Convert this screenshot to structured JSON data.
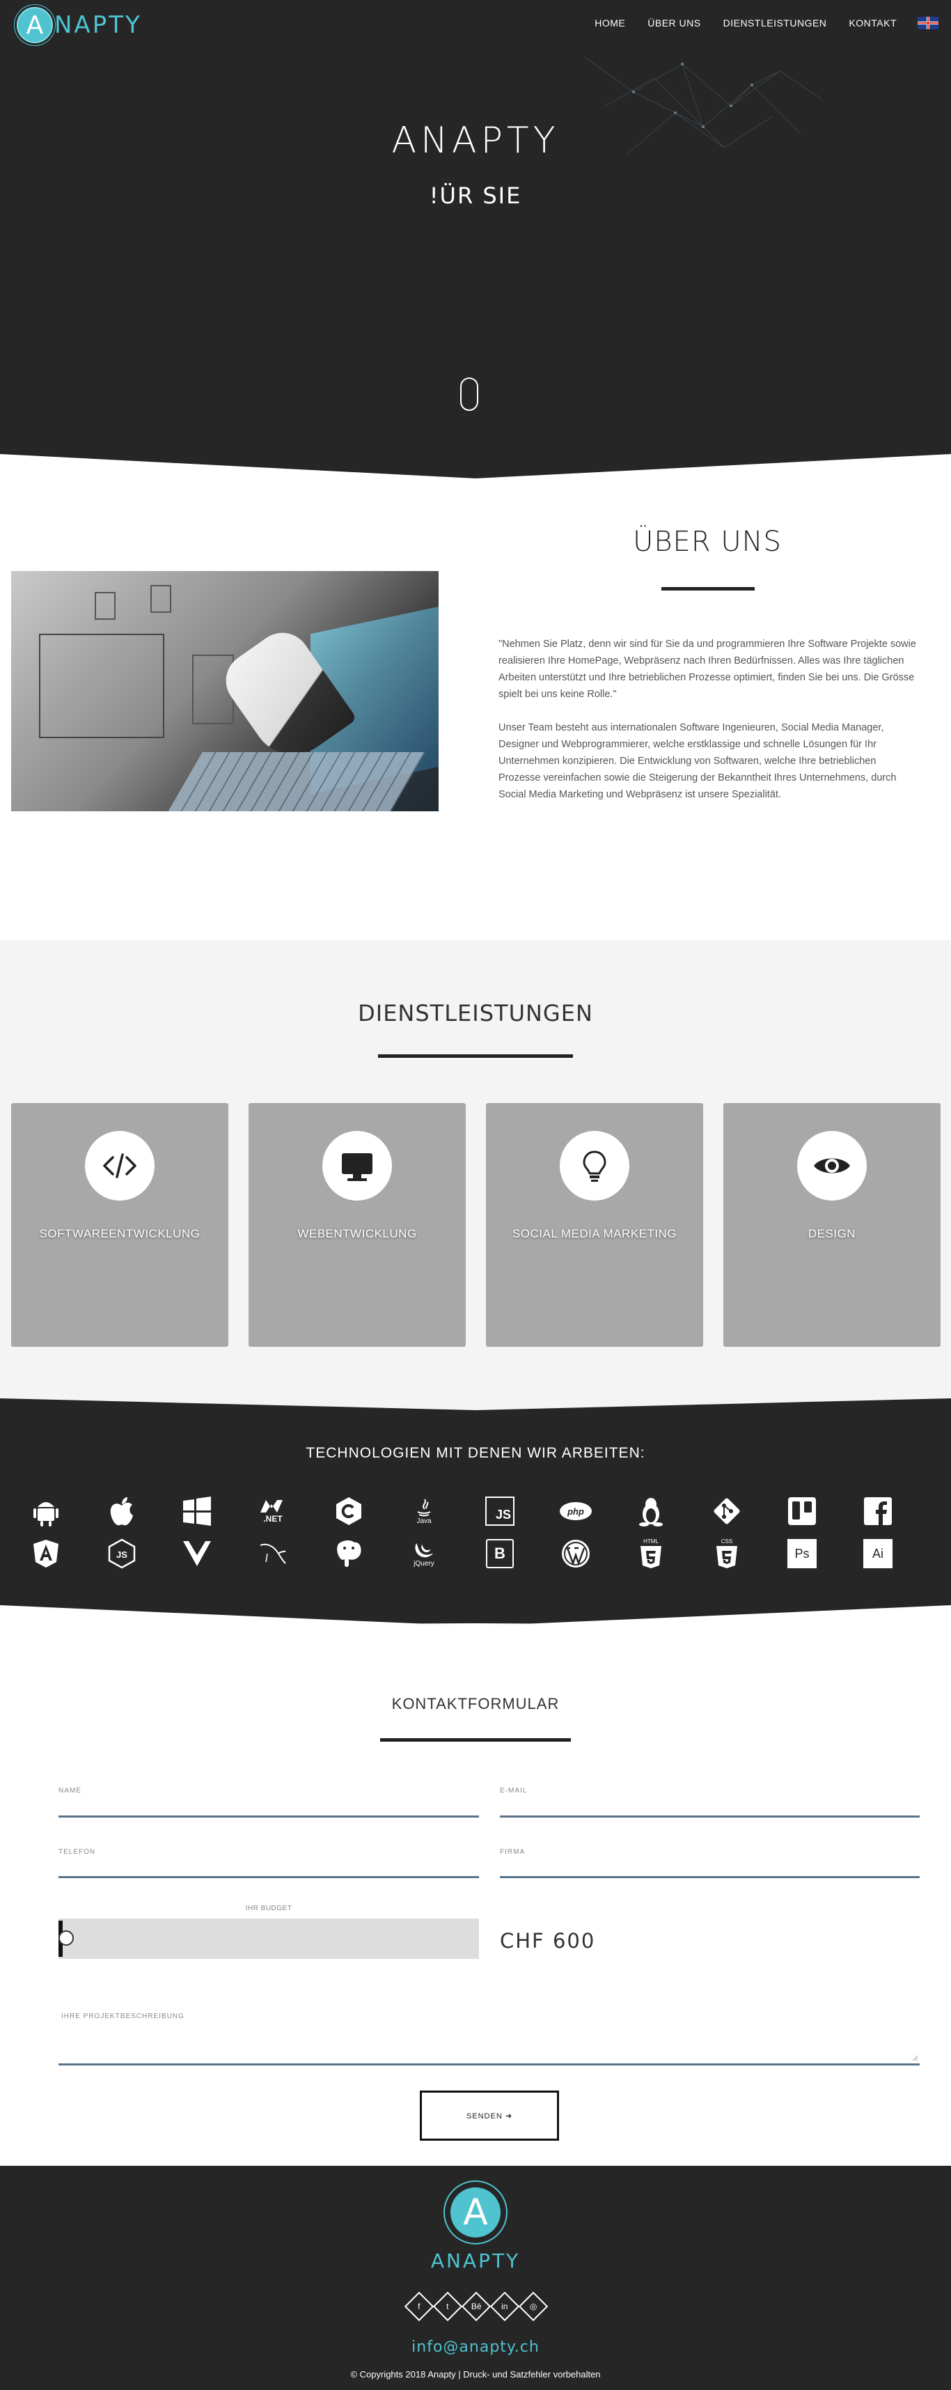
{
  "nav": {
    "logo_letter": "A",
    "logo_text": "NAPTY",
    "items": [
      {
        "label": "HOME"
      },
      {
        "label": "ÜBER UNS"
      },
      {
        "label": "DIENSTLEISTUNGEN"
      },
      {
        "label": "KONTAKT"
      }
    ],
    "language_icon": "uk-flag-icon"
  },
  "hero": {
    "title": "ANAPTY",
    "subtitle": "!ÜR SIE",
    "scroll_icon": "mouse-scroll-icon"
  },
  "about": {
    "title": "ÜBER UNS",
    "paragraph1": "\"Nehmen Sie Platz, denn wir sind für Sie da und programmieren Ihre Software Projekte sowie realisieren Ihre HomePage, Webpräsenz nach Ihren Bedürfnissen. Alles was Ihre täglichen Arbeiten unterstützt und Ihre betrieblichen Prozesse optimiert, finden Sie bei uns. Die Grösse spielt bei uns keine Rolle.\"",
    "paragraph2": "Unser Team besteht aus internationalen Software Ingenieuren, Social Media Manager, Designer und Webprogrammierer, welche erstklassige und schnelle Lösungen für Ihr Unternehmen konzipieren. Die Entwicklung von Softwaren, welche Ihre betrieblichen Prozesse vereinfachen sowie die Steigerung der Bekanntheit Ihres Unternehmens, durch Social Media Marketing und Webpräsenz ist unsere Spezialität."
  },
  "services": {
    "title": "DIENSTLEISTUNGEN",
    "items": [
      {
        "label": "SOFTWAREENTWICKLUNG",
        "icon": "code-icon"
      },
      {
        "label": "WEBENTWICKLUNG",
        "icon": "monitor-icon"
      },
      {
        "label": "SOCIAL MEDIA MARKETING",
        "icon": "lightbulb-icon"
      },
      {
        "label": "DESIGN",
        "icon": "eye-icon"
      }
    ]
  },
  "technologies": {
    "title": "TECHNOLOGIEN MIT DENEN WIR ARBEITEN:",
    "row1": [
      "android-icon",
      "apple-icon",
      "windows-icon",
      "dotnet-icon",
      "csharp-icon",
      "java-icon",
      "javascript-icon",
      "php-icon",
      "linux-icon",
      "git-icon",
      "trello-icon",
      "facebook-icon"
    ],
    "row2": [
      "angular-icon",
      "nodejs-icon",
      "vue-icon",
      "mysql-icon",
      "postgresql-icon",
      "jquery-icon",
      "bootstrap-icon",
      "wordpress-icon",
      "html5-icon",
      "css3-icon",
      "photoshop-icon",
      "illustrator-icon"
    ],
    "labels": {
      "dotnet": ".NET",
      "java": "Java",
      "js": "JS",
      "php": "php",
      "jquery": "jQuery",
      "bootstrap": "B",
      "html": "HTML",
      "css": "CSS",
      "ps": "Ps",
      "ai": "Ai"
    }
  },
  "contact": {
    "title": "KONTAKTFORMULAR",
    "name_label": "NAME",
    "email_label": "E-MAIL",
    "phone_label": "TELEFON",
    "company_label": "FIRMA",
    "budget_label": "IHR BUDGET",
    "budget_value": "CHF 600",
    "description_label": "IHRE PROJEKTBESCHREIBUNG",
    "send_label": "SENDEN ➜"
  },
  "footer": {
    "logo_letter": "A",
    "logo_text": "ANAPTY",
    "social": [
      {
        "icon": "facebook-icon",
        "glyph": "f"
      },
      {
        "icon": "twitter-icon",
        "glyph": "t"
      },
      {
        "icon": "behance-icon",
        "glyph": "Bē"
      },
      {
        "icon": "linkedin-icon",
        "glyph": "in"
      },
      {
        "icon": "dribbble-icon",
        "glyph": "◎"
      }
    ],
    "email": "info@anapty.ch",
    "copyright": "© Copyrights 2018 Anapty | Druck- und Satzfehler vorbehalten"
  },
  "colors": {
    "dark": "#262626",
    "accent": "#4fc3d0",
    "service_card": "#a8a8a8",
    "light_bg": "#f4f4f4"
  }
}
